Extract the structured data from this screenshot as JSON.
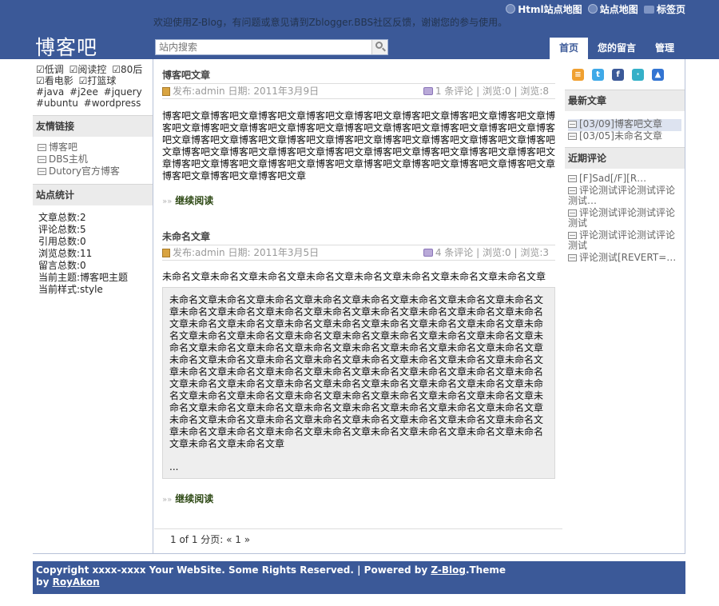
{
  "header": {
    "toplinks": [
      "Html站点地图",
      "站点地图",
      "标签页"
    ],
    "welcome": "欢迎使用Z-Blog，有问题或意见请到Zblogger.BBS社区反馈，谢谢您的参与使用。",
    "logo": "博客吧",
    "search_placeholder": "站内搜索",
    "nav": [
      "首页",
      "您的留言",
      "管理"
    ]
  },
  "left": {
    "tags": [
      "☑低调",
      "☑阅读控",
      "☑80后",
      "☑看电影",
      "☑打篮球",
      "#java",
      "#j2ee",
      "#jquery",
      "#ubuntu",
      "#wordpress"
    ],
    "links_title": "友情链接",
    "links": [
      "博客吧",
      "DBS主机",
      "Dutory官方博客"
    ],
    "stats_title": "站点统计",
    "stats": [
      "文章总数:2",
      "评论总数:5",
      "引用总数:0",
      "浏览总数:11",
      "留言总数:0",
      "当前主题:博客吧主题",
      "当前样式:style"
    ]
  },
  "posts": [
    {
      "title": "博客吧文章",
      "meta_left": "发布:admin 日期: 2011年3月9日",
      "meta_right": "1 条评论 | 浏览:0 | 浏览:8",
      "body": "博客吧文章博客吧文章博客吧文章博客吧文章博客吧文章博客吧文章博客吧文章博客吧文章博客吧文章博客吧文章博客吧文章博客吧文章博客吧文章博客吧文章博客吧文章博客吧文章博客吧文章博客吧文章博客吧文章博客吧文章博客吧文章博客吧文章博客吧文章博客吧文章博客吧文章博客吧文章博客吧文章博客吧文章博客吧文章博客吧文章博客吧文章博客吧文章博客吧文章博客吧文章博客吧文章博客吧文章博客吧文章博客吧文章博客吧文章博客吧文章博客吧文章博客吧文章博客吧文章博客吧文章",
      "readmore": "继续阅读"
    },
    {
      "title": "未命名文章",
      "meta_left": "发布:admin 日期: 2011年3月5日",
      "meta_right": "4 条评论 | 浏览:0 | 浏览:3",
      "body": "未命名文章未命名文章未命名文章未命名文章未命名文章未命名文章未命名文章未命名文章",
      "quote": "未命名文章未命名文章未命名文章未命名文章未命名文章未命名文章未命名文章未命名文章未命名文章未命名文章未命名文章未命名文章未命名文章未命名文章未命名文章未命名文章未命名文章未命名文章未命名文章未命名文章未命名文章未命名文章未命名文章未命名文章未命名文章未命名文章未命名文章未命名文章未命名文章未命名文章未命名文章未命名文章未命名文章未命名文章未命名文章未命名文章未命名文章未命名文章未命名文章未命名文章未命名文章未命名文章未命名文章未命名文章未命名文章未命名文章未命名文章未命名文章未命名文章未命名文章未命名文章未命名文章未命名文章未命名文章未命名文章未命名文章未命名文章未命名文章未命名文章未命名文章未命名文章未命名文章未命名文章未命名文章未命名文章未命名文章未命名文章未命名文章未命名文章未命名文章未命名文章未命名文章未命名文章未命名文章未命名文章未命名文章未命名文章未命名文章未命名文章未命名文章未命名文章未命名文章未命名文章未命名文章未命名文章未命名文章未命名文章未命名文章未命名文章未命名文章未命名文章未命名文章未命名文章未命名文章未命名文章未命名文章",
      "quote_more": "...",
      "readmore": "继续阅读"
    }
  ],
  "pager": "1 of 1 分页: « 1 »",
  "right": {
    "social": [
      {
        "icon": "rss-icon",
        "glyph": "≡",
        "color": "#f0a030"
      },
      {
        "icon": "twitter-icon",
        "glyph": "t",
        "color": "#3fa9e8"
      },
      {
        "icon": "facebook-icon",
        "glyph": "f",
        "color": "#3b5998"
      },
      {
        "icon": "chat-icon",
        "glyph": "·",
        "color": "#35b0c8"
      },
      {
        "icon": "delicious-icon",
        "glyph": "▲",
        "color": "#3274d2"
      }
    ],
    "recent_title": "最新文章",
    "recent": [
      "[03/09]博客吧文章",
      "[03/05]未命名文章"
    ],
    "comments_title": "近期评论",
    "comments": [
      "[F]Sad[/F][R…",
      "评论测试评论测试评论测试…",
      "评论测试评论测试评论测试",
      "评论测试评论测试评论测试",
      "评论测试[REVERT=…"
    ]
  },
  "footer": {
    "text1": "Copyright xxxx-xxxx Your WebSite. Some Rights Reserved.  | Powered by ",
    "link1": "Z-Blog",
    "text2": ".Theme",
    "text3": "by ",
    "link2": "RoyAkon"
  }
}
